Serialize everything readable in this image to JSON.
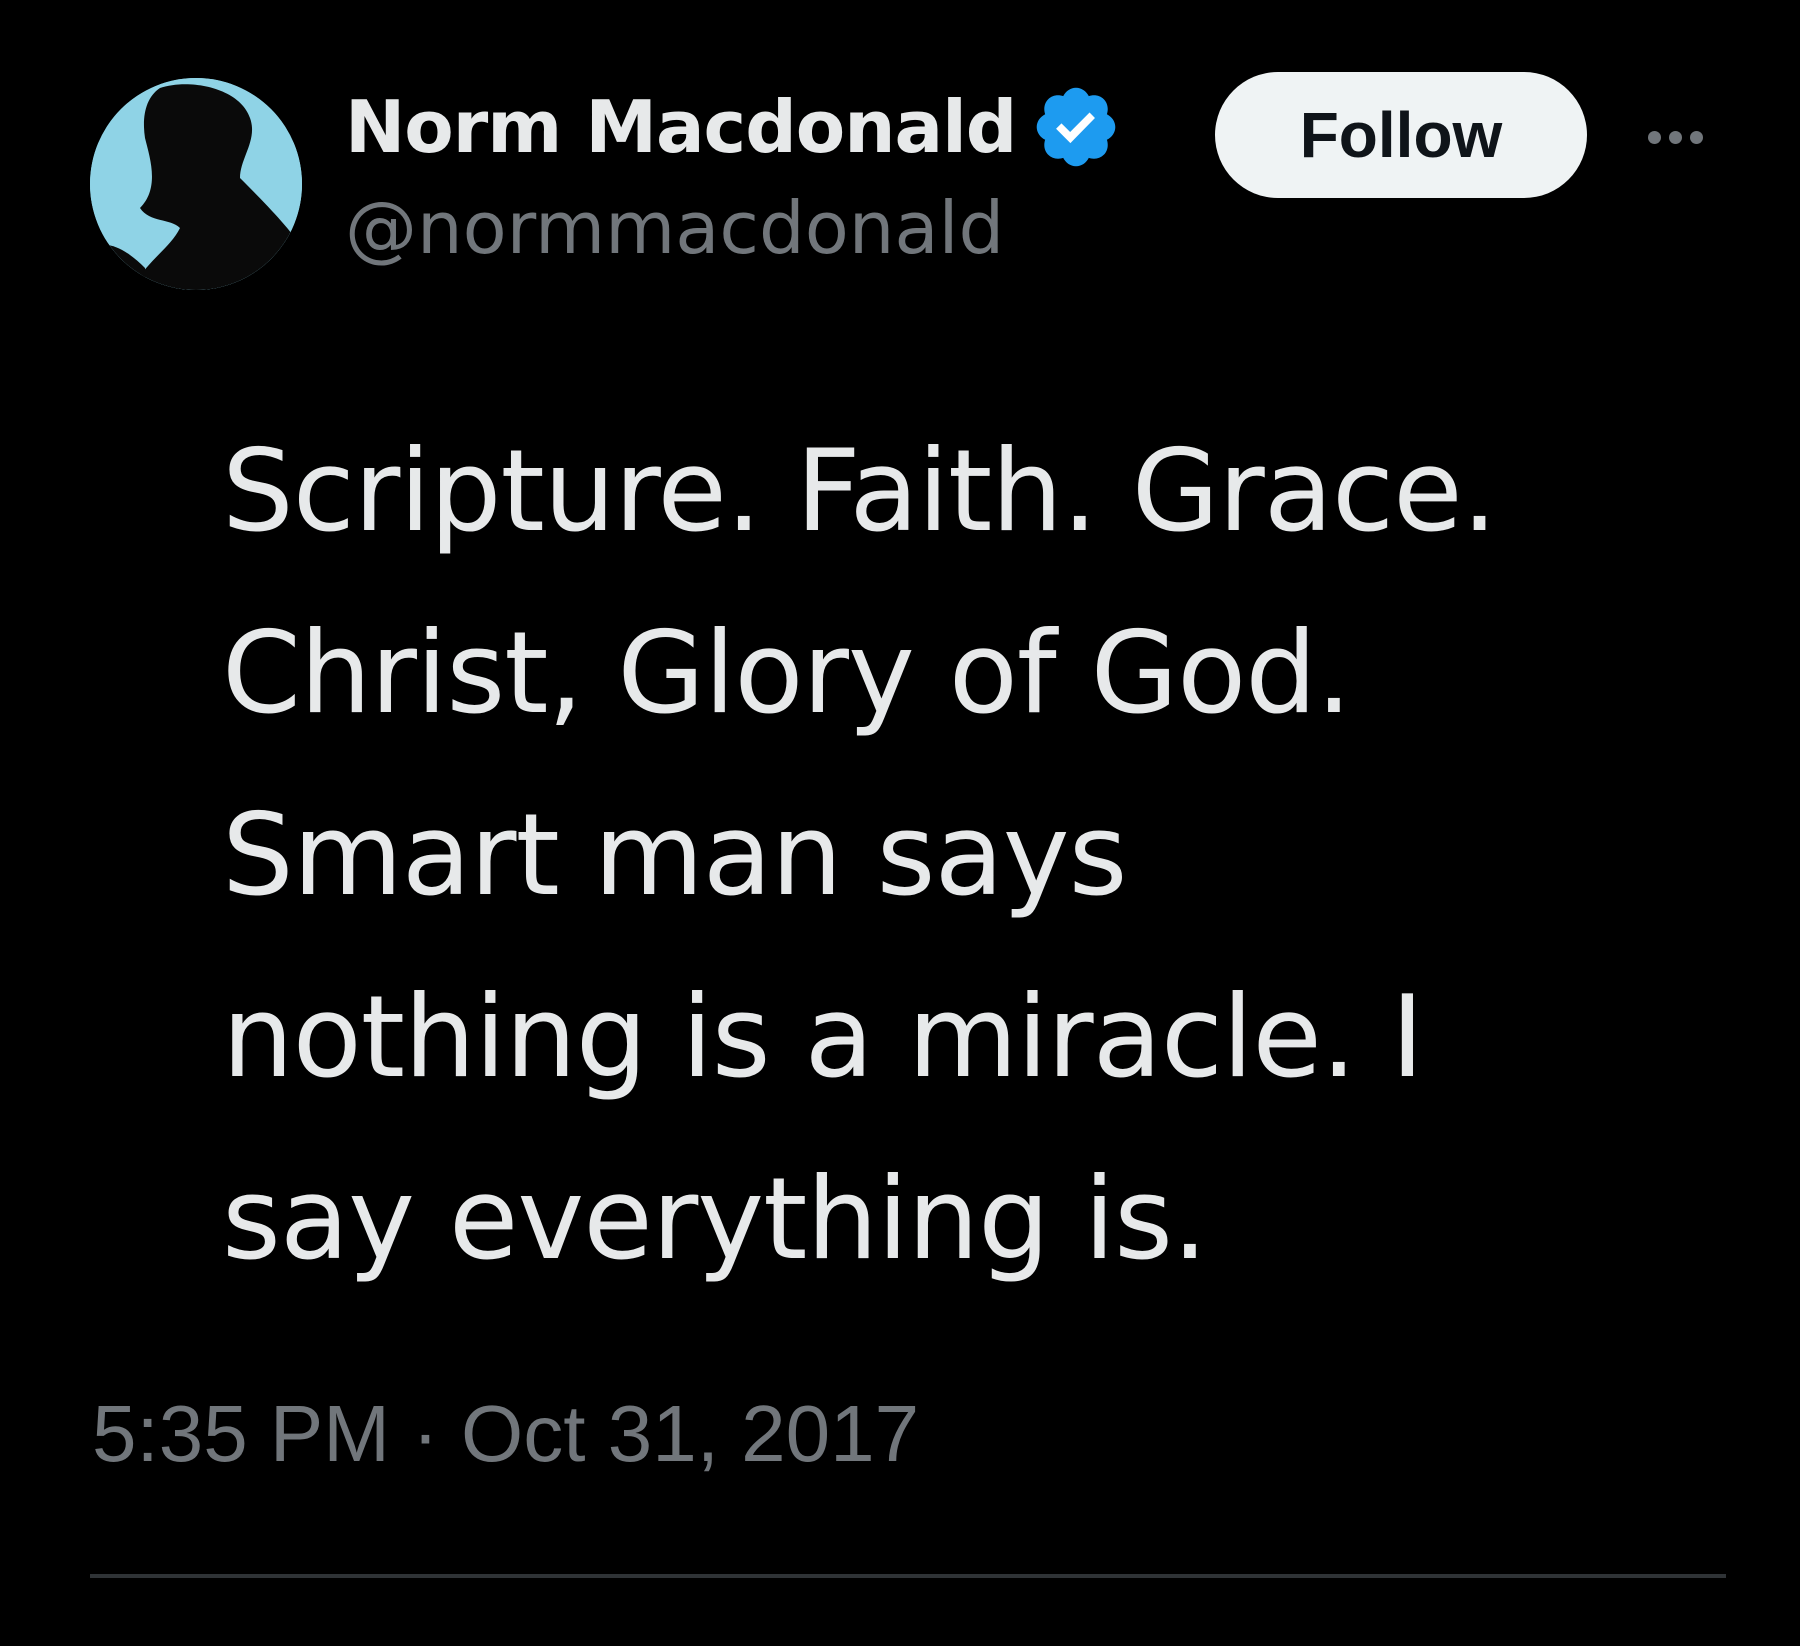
{
  "author": {
    "display_name": "Norm Macdonald",
    "handle": "@normmacdonald",
    "verified": true,
    "avatar_icon": "avatar-silhouette"
  },
  "actions": {
    "follow_label": "Follow",
    "more_icon": "more-horizontal-icon"
  },
  "tweet": {
    "lines": [
      "Scripture. Faith. Grace.",
      "Christ, Glory of God.",
      "Smart man says",
      "nothing is a miracle. I",
      "say everything is."
    ],
    "timestamp": "5:35 PM · Oct 31, 2017"
  },
  "colors": {
    "background": "#000000",
    "text_primary": "#e7e9ea",
    "text_secondary": "#71767b",
    "verified_blue": "#1d9bf0",
    "follow_button_bg": "#eff3f4",
    "divider": "#2f3336"
  }
}
